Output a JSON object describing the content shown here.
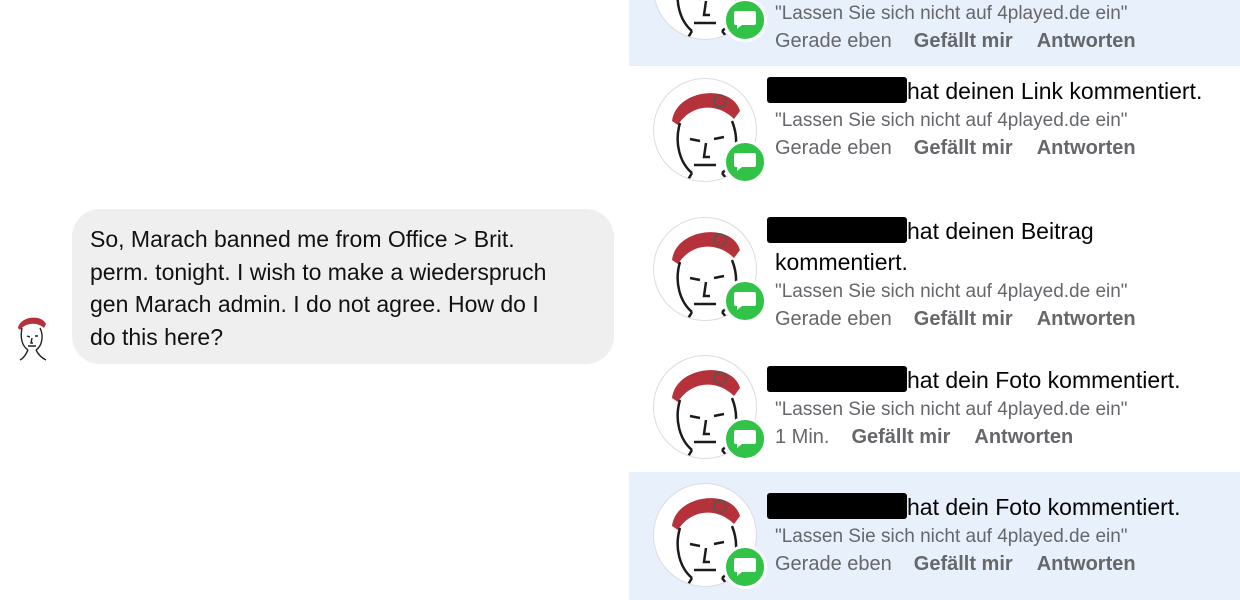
{
  "chat": {
    "message": "So, Marach banned me from Office > Brit.\nperm. tonight.  I wish to make a wiederspruch\ngen Marach admin.   I do not agree.  How do I\ndo this here?"
  },
  "notifications": [
    {
      "title_suffix": "",
      "quote": "\"Lassen Sie sich nicht auf 4played.de ein\"",
      "time": "Gerade eben",
      "like": "Gefällt mir",
      "reply": "Antworten",
      "unread": true
    },
    {
      "title_suffix": "hat deinen Link kommentiert.",
      "quote": "\"Lassen Sie sich nicht auf 4played.de ein\"",
      "time": "Gerade eben",
      "like": "Gefällt mir",
      "reply": "Antworten",
      "unread": false
    },
    {
      "title_suffix": "hat deinen Beitrag kommentiert.",
      "quote": "\"Lassen Sie sich nicht auf 4played.de ein\"",
      "time": "Gerade eben",
      "like": "Gefällt mir",
      "reply": "Antworten",
      "unread": false
    },
    {
      "title_suffix": "hat dein Foto kommentiert.",
      "quote": "\"Lassen Sie sich nicht auf 4played.de ein\"",
      "time": "1 Min.",
      "like": "Gefällt mir",
      "reply": "Antworten",
      "unread": false
    },
    {
      "title_suffix": "hat dein Foto kommentiert.",
      "quote": "\"Lassen Sie sich nicht auf 4played.de ein\"",
      "time": "Gerade eben",
      "like": "Gefällt mir",
      "reply": "Antworten",
      "unread": true
    }
  ],
  "more_icon": "••",
  "icons": {
    "avatar": "sketch-face-red-beret-avatar",
    "badge": "comment-bubble-icon",
    "more": "more-dots-icon"
  },
  "colors": {
    "unread_bg": "#e7f0fb",
    "badge_green": "#31c348",
    "bubble_bg": "#efefef",
    "meta_gray": "#65676b"
  }
}
